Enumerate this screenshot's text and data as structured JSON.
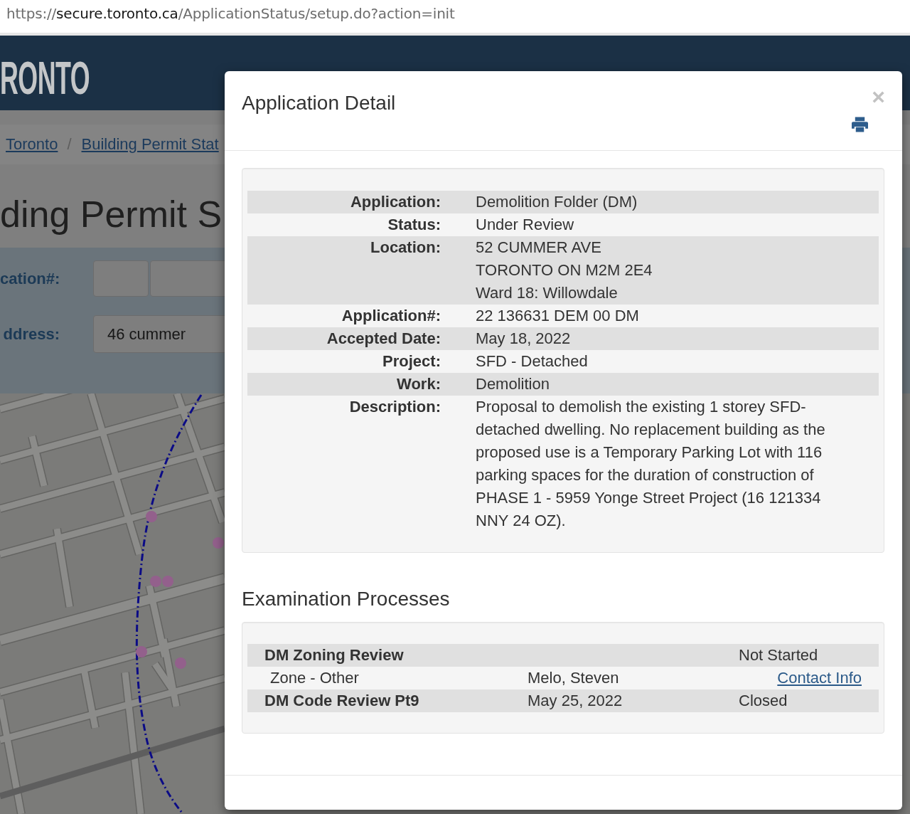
{
  "browser": {
    "url": {
      "scheme": "https://",
      "host": "secure.toronto.ca",
      "path": "/ApplicationStatus/setup.do?action=init"
    }
  },
  "site": {
    "logo": "RONTO",
    "breadcrumbs": {
      "items": [
        "Toronto",
        "Building Permit Stat"
      ],
      "separator": "/"
    },
    "heading": "ding Permit S",
    "search_form": {
      "fields": [
        {
          "kind": "split",
          "label": "cation#:"
        },
        {
          "kind": "text",
          "label": "ddress:",
          "value": "46 cummer"
        }
      ]
    }
  },
  "dialog": {
    "title": "Application Detail",
    "close_symbol": "×",
    "details": [
      {
        "label": "Application:",
        "value": "Demolition Folder (DM)"
      },
      {
        "label": "Status:",
        "value": "Under Review"
      },
      {
        "label": "Location:",
        "lines": [
          "52 CUMMER AVE",
          "TORONTO ON M2M 2E4",
          "Ward 18: Willowdale"
        ]
      },
      {
        "label": "Application#:",
        "value": "22 136631 DEM 00 DM"
      },
      {
        "label": "Accepted Date:",
        "value": "May 18, 2022"
      },
      {
        "label": "Project:",
        "value": "SFD - Detached"
      },
      {
        "label": "Work:",
        "value": "Demolition"
      },
      {
        "label": "Description:",
        "value": "Proposal to demolish the existing 1 storey SFD-detached dwelling. No replacement building as the proposed use is a Temporary Parking Lot with 116 parking spaces for the duration of construction of PHASE 1 - 5959 Yonge Street Project (16 121334 NNY 24 OZ)."
      }
    ],
    "section_title": "Examination Processes",
    "processes": [
      {
        "kind": "process",
        "name": "DM Zoning Review",
        "status": "Not Started"
      },
      {
        "kind": "reviewer",
        "zone": "Zone - Other",
        "examiner": "Melo, Steven",
        "link": "Contact Info"
      },
      {
        "kind": "process",
        "name": "DM Code Review Pt9",
        "date": "May 25, 2022",
        "status": "Closed"
      }
    ]
  }
}
